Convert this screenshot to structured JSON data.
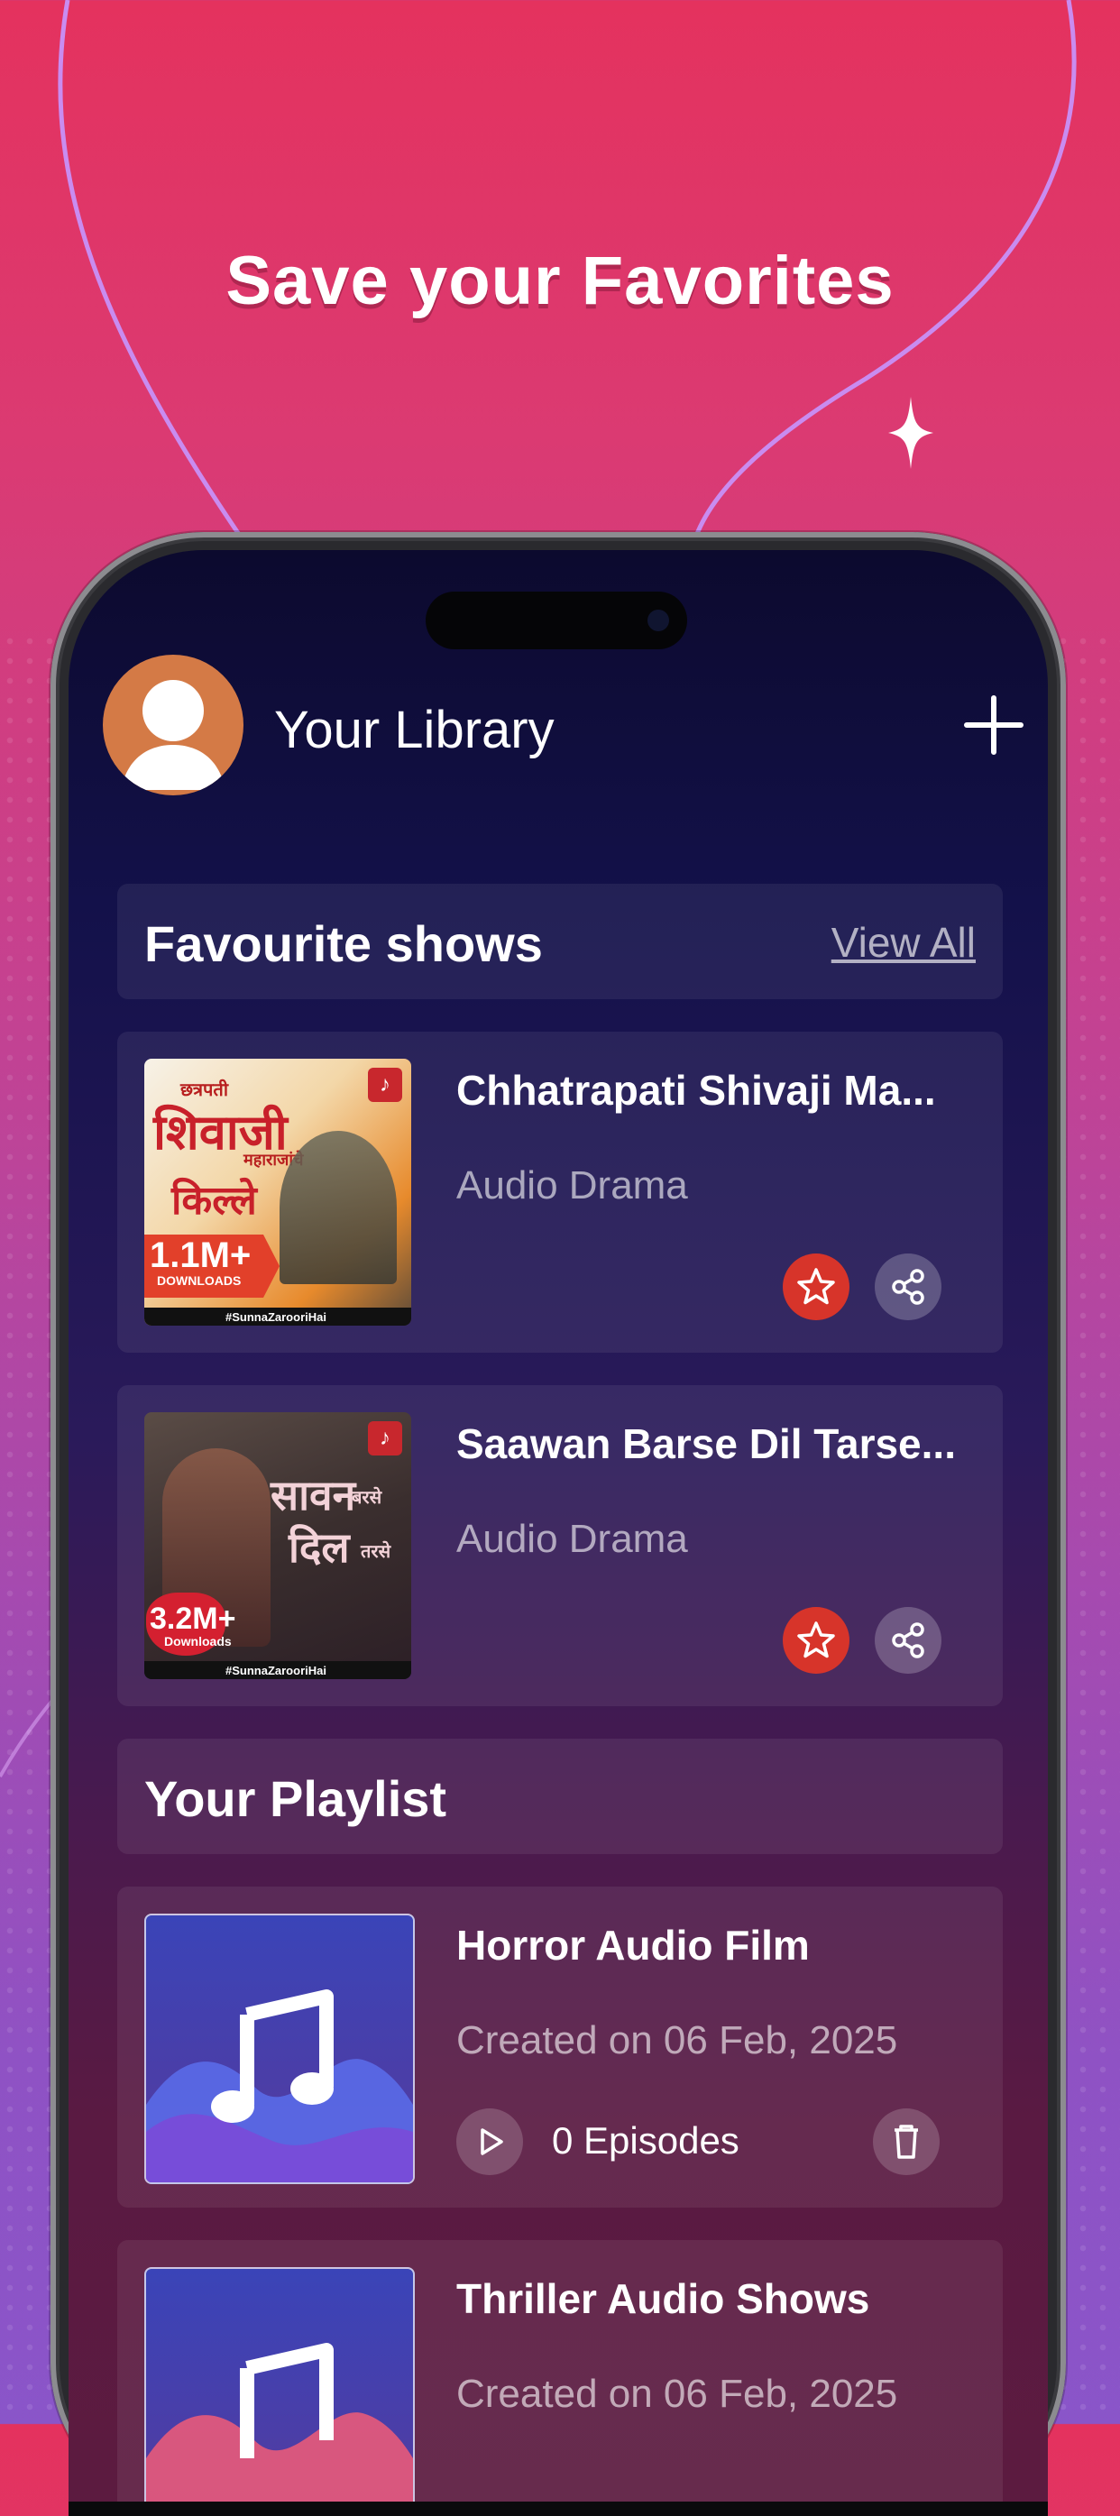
{
  "headline": "Save your Favorites",
  "library": {
    "title": "Your Library",
    "avatar_icon": "user-avatar-icon",
    "add_icon": "plus-icon"
  },
  "favourites": {
    "title": "Favourite shows",
    "view_all": "View All",
    "items": [
      {
        "title": "Chhatrapati Shivaji Ma...",
        "subtitle": "Audio Drama",
        "poster": {
          "top_text": "छत्रपती",
          "main_text": "शिवाजी",
          "mid_text": "महाराजांचे",
          "bottom_text": "किल्ले",
          "badge": "1.1M+",
          "badge_sub": "DOWNLOADS",
          "tag": "#SunnaZarooriHai"
        }
      },
      {
        "title": "Saawan Barse Dil Tarse...",
        "subtitle": "Audio Drama",
        "poster": {
          "line1": "सावन",
          "line1b": "बरसे",
          "line2": "दिल",
          "line2b": "तरसे",
          "badge": "3.2M+",
          "badge_sub": "Downloads",
          "tag": "#SunnaZarooriHai"
        }
      }
    ]
  },
  "playlist": {
    "title": "Your Playlist",
    "items": [
      {
        "title": "Horror Audio Film",
        "created": "Created on 06 Feb, 2025",
        "episodes": "0 Episodes"
      },
      {
        "title": "Thriller Audio Shows",
        "created": "Created on 06 Feb, 2025"
      }
    ]
  },
  "colors": {
    "star": "#d7342a",
    "accent": "#e4325e",
    "avatar": "#d47a46"
  }
}
